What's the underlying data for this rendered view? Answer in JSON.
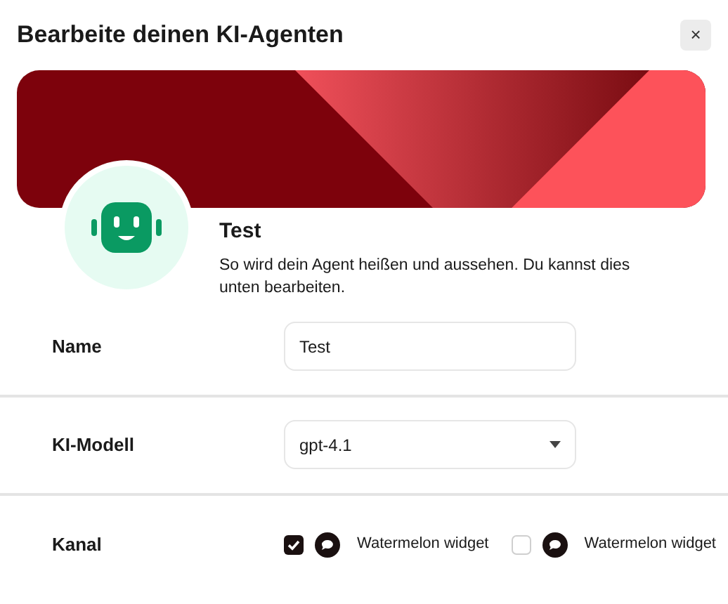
{
  "dialog": {
    "title": "Bearbeite deinen KI-Agenten",
    "close": "×"
  },
  "agent": {
    "name": "Test",
    "description": "So wird dein Agent heißen und aussehen. Du kannst dies unten bearbeiten."
  },
  "form": [
    {
      "kind": "text",
      "label": "Name",
      "value": "Test"
    },
    {
      "kind": "select",
      "label": "KI-Modell",
      "value": "gpt-4.1"
    },
    {
      "kind": "channels",
      "label": "Kanal",
      "options": [
        {
          "label": "Watermelon widget",
          "checked": true
        },
        {
          "label": "Watermelon widget",
          "checked": false
        }
      ]
    }
  ]
}
